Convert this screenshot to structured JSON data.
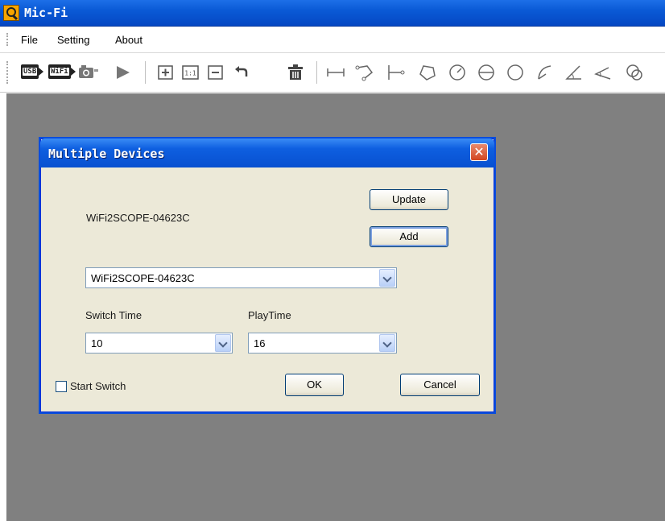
{
  "window": {
    "title": "Mic-Fi"
  },
  "menu": [
    "File",
    "Setting",
    "About"
  ],
  "toolbar": {
    "usb_label": "USB",
    "wifi_label": "WiFi",
    "zoom_actual_label": "1:1"
  },
  "dialog": {
    "title": "Multiple Devices",
    "device_name": "WiFi2SCOPE-04623C",
    "update_label": "Update",
    "add_label": "Add",
    "device_select_value": "WiFi2SCOPE-04623C",
    "switch_time_label": "Switch Time",
    "play_time_label": "PlayTime",
    "switch_time_value": "10",
    "play_time_value": "16",
    "start_switch_label": "Start Switch",
    "ok_label": "OK",
    "cancel_label": "Cancel"
  },
  "colors": {
    "titlebar_blue": "#0a5ad6",
    "workspace_gray": "#808080",
    "dialog_bg": "#ece9d8",
    "close_red": "#d2451f"
  }
}
